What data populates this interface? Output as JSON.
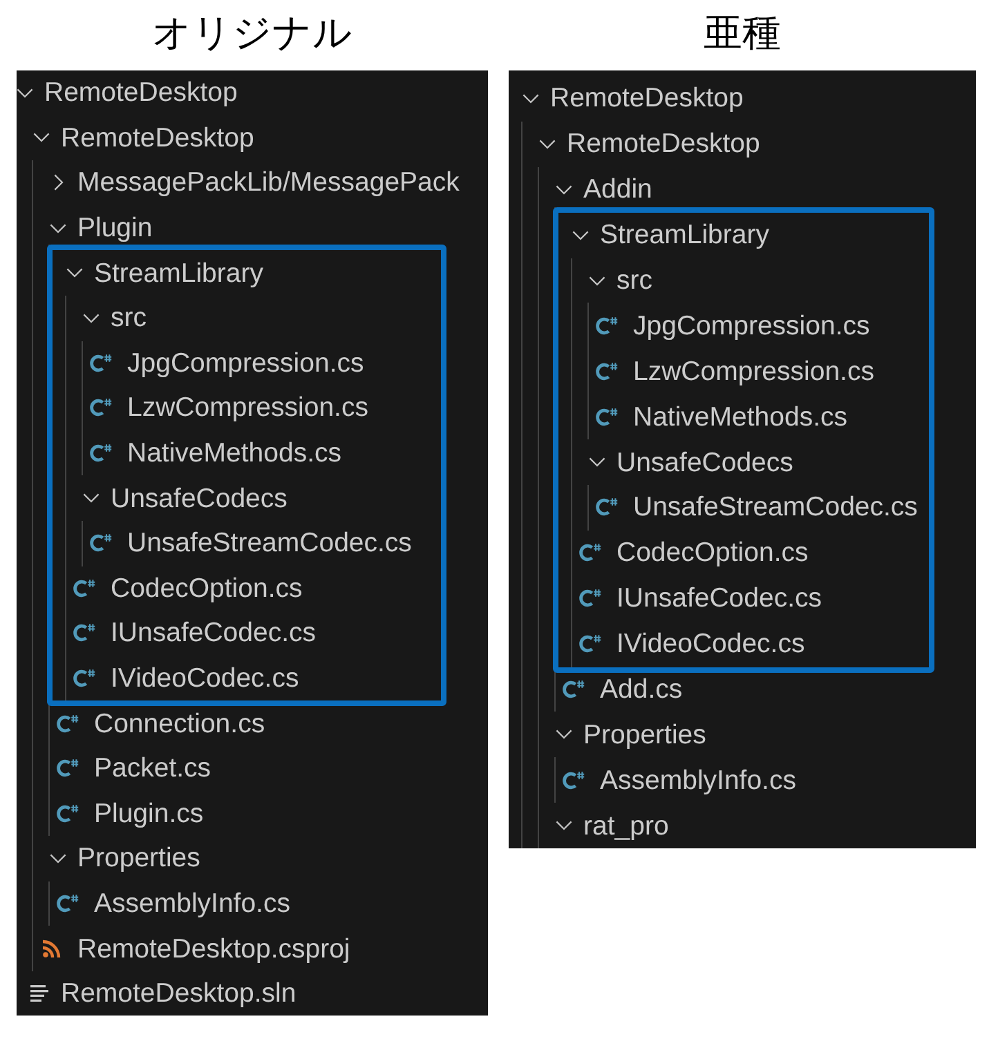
{
  "panels": [
    {
      "title": "オリジナル",
      "tree": [
        {
          "kind": "folder",
          "label": "RemoteDesktop",
          "expanded": true,
          "children": [
            {
              "kind": "folder",
              "label": "RemoteDesktop",
              "expanded": true,
              "children": [
                {
                  "kind": "folder",
                  "label": "MessagePackLib/MessagePack",
                  "expanded": false
                },
                {
                  "kind": "folder",
                  "label": "Plugin",
                  "expanded": true,
                  "children": [
                    {
                      "kind": "folder",
                      "label": "StreamLibrary",
                      "expanded": true,
                      "highlighted": true,
                      "children": [
                        {
                          "kind": "folder",
                          "label": "src",
                          "expanded": true,
                          "children": [
                            {
                              "kind": "csharp",
                              "label": "JpgCompression.cs"
                            },
                            {
                              "kind": "csharp",
                              "label": "LzwCompression.cs"
                            },
                            {
                              "kind": "csharp",
                              "label": "NativeMethods.cs"
                            }
                          ]
                        },
                        {
                          "kind": "folder",
                          "label": "UnsafeCodecs",
                          "expanded": true,
                          "children": [
                            {
                              "kind": "csharp",
                              "label": "UnsafeStreamCodec.cs"
                            }
                          ]
                        },
                        {
                          "kind": "csharp",
                          "label": "CodecOption.cs"
                        },
                        {
                          "kind": "csharp",
                          "label": "IUnsafeCodec.cs"
                        },
                        {
                          "kind": "csharp",
                          "label": "IVideoCodec.cs"
                        }
                      ]
                    },
                    {
                      "kind": "csharp",
                      "label": "Connection.cs"
                    },
                    {
                      "kind": "csharp",
                      "label": "Packet.cs"
                    },
                    {
                      "kind": "csharp",
                      "label": "Plugin.cs"
                    }
                  ]
                },
                {
                  "kind": "folder",
                  "label": "Properties",
                  "expanded": true,
                  "children": [
                    {
                      "kind": "csharp",
                      "label": "AssemblyInfo.cs"
                    }
                  ]
                },
                {
                  "kind": "project",
                  "label": "RemoteDesktop.csproj"
                }
              ]
            },
            {
              "kind": "solution",
              "label": "RemoteDesktop.sln"
            }
          ]
        }
      ]
    },
    {
      "title": "亜種",
      "tree": [
        {
          "kind": "folder",
          "label": "RemoteDesktop",
          "expanded": true,
          "children": [
            {
              "kind": "folder",
              "label": "RemoteDesktop",
              "expanded": true,
              "children": [
                {
                  "kind": "folder",
                  "label": "Addin",
                  "expanded": true,
                  "children": [
                    {
                      "kind": "folder",
                      "label": "StreamLibrary",
                      "expanded": true,
                      "highlighted": true,
                      "children": [
                        {
                          "kind": "folder",
                          "label": "src",
                          "expanded": true,
                          "children": [
                            {
                              "kind": "csharp",
                              "label": "JpgCompression.cs"
                            },
                            {
                              "kind": "csharp",
                              "label": "LzwCompression.cs"
                            },
                            {
                              "kind": "csharp",
                              "label": "NativeMethods.cs"
                            }
                          ]
                        },
                        {
                          "kind": "folder",
                          "label": "UnsafeCodecs",
                          "expanded": true,
                          "children": [
                            {
                              "kind": "csharp",
                              "label": "UnsafeStreamCodec.cs"
                            }
                          ]
                        },
                        {
                          "kind": "csharp",
                          "label": "CodecOption.cs"
                        },
                        {
                          "kind": "csharp",
                          "label": "IUnsafeCodec.cs"
                        },
                        {
                          "kind": "csharp",
                          "label": "IVideoCodec.cs"
                        }
                      ]
                    },
                    {
                      "kind": "csharp",
                      "label": "Add.cs"
                    }
                  ]
                },
                {
                  "kind": "folder",
                  "label": "Properties",
                  "expanded": true,
                  "children": [
                    {
                      "kind": "csharp",
                      "label": "AssemblyInfo.cs"
                    }
                  ]
                },
                {
                  "kind": "folder",
                  "label": "rat_pro",
                  "expanded": true
                }
              ]
            }
          ]
        }
      ]
    }
  ]
}
